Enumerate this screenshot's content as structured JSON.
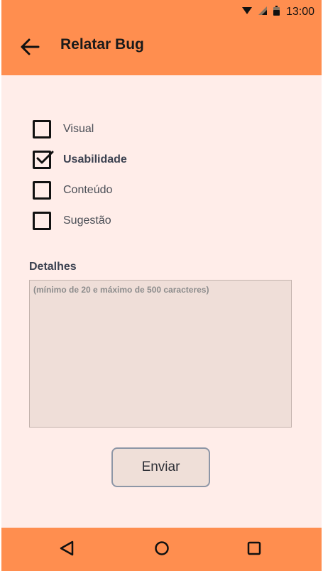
{
  "status_bar": {
    "time": "13:00",
    "icons": [
      "wifi-icon",
      "cell-signal-icon",
      "battery-icon"
    ]
  },
  "app_bar": {
    "title": "Relatar Bug",
    "back_icon": "arrow-back-icon"
  },
  "options": [
    {
      "label": "Visual",
      "checked": false
    },
    {
      "label": "Usabilidade",
      "checked": true
    },
    {
      "label": "Conteúdo",
      "checked": false
    },
    {
      "label": "Sugestão",
      "checked": false
    }
  ],
  "details": {
    "label": "Detalhes",
    "placeholder": "(mínimo de 20 e máximo de 500 caracteres)",
    "value": ""
  },
  "submit": {
    "label": "Enviar"
  },
  "nav_bar": {
    "icons": [
      "nav-back-icon",
      "nav-home-icon",
      "nav-recents-icon"
    ]
  },
  "colors": {
    "bar": "#ff8e4f",
    "background": "#ffede9",
    "textarea": "#efded8",
    "button_border": "#8d96a6"
  }
}
